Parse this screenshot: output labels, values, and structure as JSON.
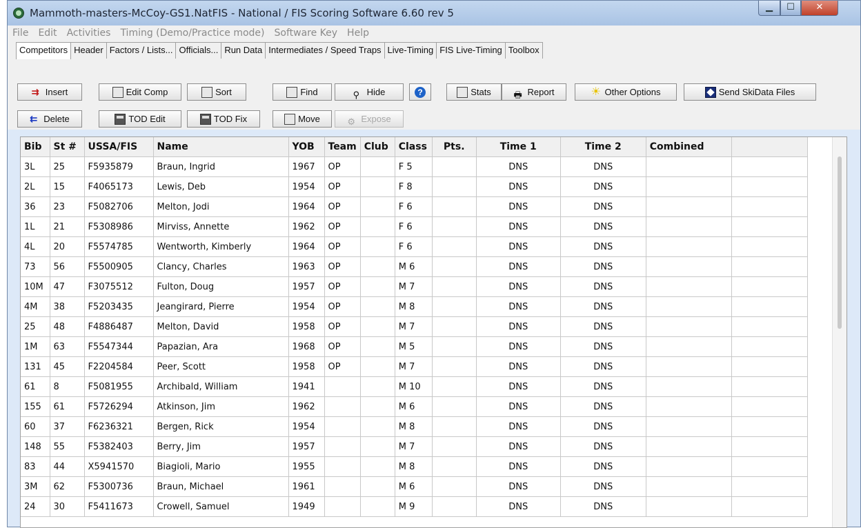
{
  "window": {
    "title": "Mammoth-masters-McCoy-GS1.NatFIS - National / FIS Scoring Software 6.60 rev 5"
  },
  "menu": [
    "File",
    "Edit",
    "Activities",
    "Timing (Demo/Practice mode)",
    "Software Key",
    "Help"
  ],
  "tabs": [
    "Competitors",
    "Header",
    "Factors / Lists...",
    "Officials...",
    "Run Data",
    "Intermediates / Speed Traps",
    "Live-Timing",
    "FIS Live-Timing",
    "Toolbox"
  ],
  "toolbar": {
    "insert": "Insert",
    "delete": "Delete",
    "edit_comp": "Edit Comp",
    "sort": "Sort",
    "find": "Find",
    "hide": "Hide",
    "stats": "Stats",
    "report": "Report",
    "other_options": "Other Options",
    "send_skidata": "Send SkiData Files",
    "tod_edit": "TOD Edit",
    "tod_fix": "TOD Fix",
    "move": "Move",
    "expose": "Expose"
  },
  "table": {
    "headers": [
      "Bib",
      "St #",
      "USSA/FIS",
      "Name",
      "YOB",
      "Team",
      "Club",
      "Class",
      "Pts.",
      "Time 1",
      "Time 2",
      "Combined"
    ],
    "rows": [
      [
        "3L",
        "25",
        "F5935879",
        "Braun, Ingrid",
        "1967",
        "OP",
        "",
        "F 5",
        "",
        "DNS",
        "DNS",
        ""
      ],
      [
        "2L",
        "15",
        "F4065173",
        "Lewis, Deb",
        "1954",
        "OP",
        "",
        "F 8",
        "",
        "DNS",
        "DNS",
        ""
      ],
      [
        "36",
        "23",
        "F5082706",
        "Melton, Jodi",
        "1964",
        "OP",
        "",
        "F 6",
        "",
        "DNS",
        "DNS",
        ""
      ],
      [
        "1L",
        "21",
        "F5308986",
        "Mirviss, Annette",
        "1962",
        "OP",
        "",
        "F 6",
        "",
        "DNS",
        "DNS",
        ""
      ],
      [
        "4L",
        "20",
        "F5574785",
        "Wentworth, Kimberly",
        "1964",
        "OP",
        "",
        "F 6",
        "",
        "DNS",
        "DNS",
        ""
      ],
      [
        "73",
        "56",
        "F5500905",
        "Clancy, Charles",
        "1963",
        "OP",
        "",
        "M 6",
        "",
        "DNS",
        "DNS",
        ""
      ],
      [
        "10M",
        "47",
        "F3075512",
        "Fulton, Doug",
        "1957",
        "OP",
        "",
        "M 7",
        "",
        "DNS",
        "DNS",
        ""
      ],
      [
        "4M",
        "38",
        "F5203435",
        "Jeangirard, Pierre",
        "1954",
        "OP",
        "",
        "M 8",
        "",
        "DNS",
        "DNS",
        ""
      ],
      [
        "25",
        "48",
        "F4886487",
        "Melton, David",
        "1958",
        "OP",
        "",
        "M 7",
        "",
        "DNS",
        "DNS",
        ""
      ],
      [
        "1M",
        "63",
        "F5547344",
        "Papazian, Ara",
        "1968",
        "OP",
        "",
        "M 5",
        "",
        "DNS",
        "DNS",
        ""
      ],
      [
        "131",
        "45",
        "F2204584",
        "Peer, Scott",
        "1958",
        "OP",
        "",
        "M 7",
        "",
        "DNS",
        "DNS",
        ""
      ],
      [
        "61",
        "8",
        "F5081955",
        "Archibald, William",
        "1941",
        "",
        "",
        "M 10",
        "",
        "DNS",
        "DNS",
        ""
      ],
      [
        "155",
        "61",
        "F5726294",
        "Atkinson, Jim",
        "1962",
        "",
        "",
        "M 6",
        "",
        "DNS",
        "DNS",
        ""
      ],
      [
        "60",
        "37",
        "F6236321",
        "Bergen, Rick",
        "1954",
        "",
        "",
        "M 8",
        "",
        "DNS",
        "DNS",
        ""
      ],
      [
        "148",
        "55",
        "F5382403",
        "Berry, Jim",
        "1957",
        "",
        "",
        "M 7",
        "",
        "DNS",
        "DNS",
        ""
      ],
      [
        "83",
        "44",
        "X5941570",
        "Biagioli, Mario",
        "1955",
        "",
        "",
        "M 8",
        "",
        "DNS",
        "DNS",
        ""
      ],
      [
        "3M",
        "62",
        "F5300736",
        "Braun, Michael",
        "1961",
        "",
        "",
        "M 6",
        "",
        "DNS",
        "DNS",
        ""
      ],
      [
        "24",
        "30",
        "F5411673",
        "Crowell, Samuel",
        "1949",
        "",
        "",
        "M 9",
        "",
        "DNS",
        "DNS",
        ""
      ]
    ]
  }
}
